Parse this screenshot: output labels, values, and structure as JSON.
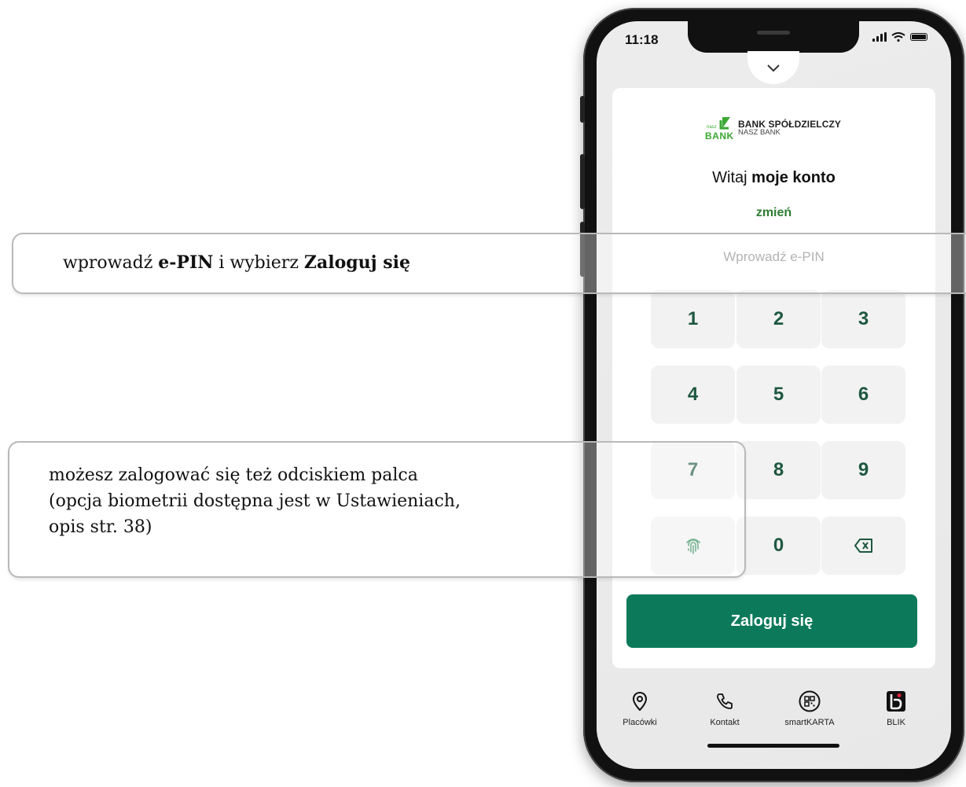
{
  "callouts": {
    "enter_pin": {
      "part1": "wprowadź ",
      "bold1": "e-PIN",
      "part2": " i wybierz ",
      "bold2": "Zaloguj się"
    },
    "fingerprint": {
      "line1": "możesz zalogować się też odciskiem palca",
      "line2": "(opcja biometrii dostępna jest w Ustawieniach,",
      "line3": "opis str. 38)"
    }
  },
  "status_bar": {
    "time": "11:18",
    "icons": [
      "signal-icon",
      "wifi-icon",
      "battery-icon"
    ]
  },
  "app": {
    "collapse_icon": "chevron-down-icon",
    "logo": {
      "small": "nasz",
      "word": "BANK",
      "name": "BANK SPÓŁDZIELCZY",
      "sub": "NASZ BANK"
    },
    "greeting_prefix": "Witaj ",
    "greeting_bold": "moje konto",
    "change_link": "zmień",
    "pin_placeholder": "Wprowadź e-PIN",
    "keypad": [
      "1",
      "2",
      "3",
      "4",
      "5",
      "6",
      "7",
      "8",
      "9",
      "0"
    ],
    "fingerprint_icon": "fingerprint-icon",
    "backspace_icon": "backspace-icon",
    "login_button": "Zaloguj się"
  },
  "bottom_nav": [
    {
      "label": "Placówki",
      "icon": "location-pin-icon"
    },
    {
      "label": "Kontakt",
      "icon": "phone-icon"
    },
    {
      "label": "smartKARTA",
      "icon": "qr-code-icon"
    },
    {
      "label": "BLIK",
      "icon": "blik-icon"
    }
  ],
  "colors": {
    "brand_green": "#0c7a5a",
    "link_green": "#2e7d32",
    "key_digit": "#1e5840"
  }
}
